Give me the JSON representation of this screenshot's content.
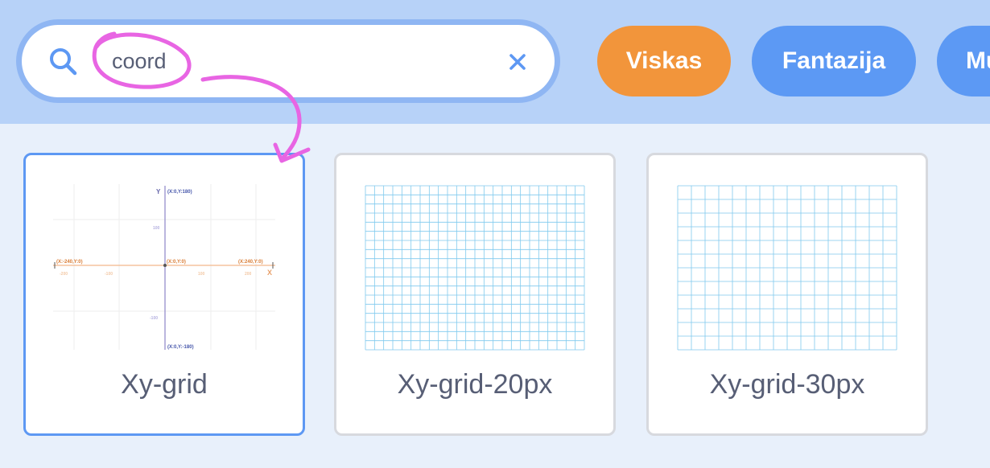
{
  "search": {
    "value": "coord",
    "icon": "search-icon",
    "clear_icon": "close-icon"
  },
  "categories": [
    {
      "label": "Viskas",
      "color": "#f2953b",
      "selected": true
    },
    {
      "label": "Fantazija",
      "color": "#5c99f4"
    },
    {
      "label": "Mu",
      "color": "#5c99f4"
    }
  ],
  "results": [
    {
      "name": "Xy-grid",
      "selected": true,
      "thumbnail": {
        "y_axis_label": "Y",
        "x_axis_label": "X",
        "top_label": "(X:0,Y:180)",
        "bottom_label": "(X:0,Y:-180)",
        "left_label": "(X:-240,Y:0)",
        "right_label": "(X:240,Y:0)",
        "center_label": "(X:0,Y:0)",
        "x_ticks": [
          "-200",
          "-100",
          "100",
          "200"
        ],
        "y_ticks": [
          "100",
          "-100"
        ]
      }
    },
    {
      "name": "Xy-grid-20px",
      "grid_spacing": 20
    },
    {
      "name": "Xy-grid-30px",
      "grid_spacing": 30
    }
  ],
  "colors": {
    "header_bg": "#b7d2f8",
    "page_bg": "#e8f0fb",
    "selected_border": "#5d98f3",
    "annotation": "#e865e3",
    "grid_line": "#7fc9ee"
  }
}
